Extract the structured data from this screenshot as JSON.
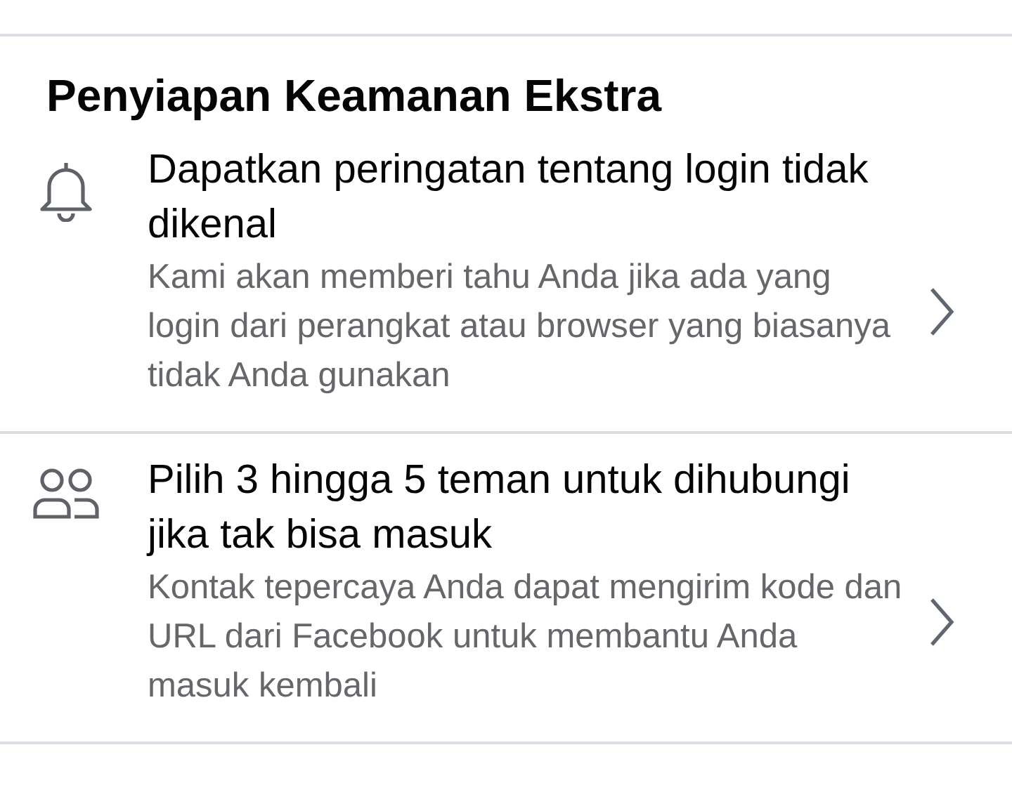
{
  "section": {
    "title": "Penyiapan Keamanan Ekstra"
  },
  "items": [
    {
      "kind": "alerts",
      "title": "Dapatkan peringatan tentang login tidak dikenal",
      "description": "Kami akan memberi tahu Anda jika ada yang login dari perangkat atau browser yang biasanya tidak Anda gunakan"
    },
    {
      "kind": "friends",
      "title": "Pilih 3 hingga 5 teman untuk dihubungi jika tak bisa masuk",
      "description": "Kontak tepercaya Anda dapat mengirim kode dan URL dari Facebook untuk membantu Anda masuk kembali"
    }
  ]
}
